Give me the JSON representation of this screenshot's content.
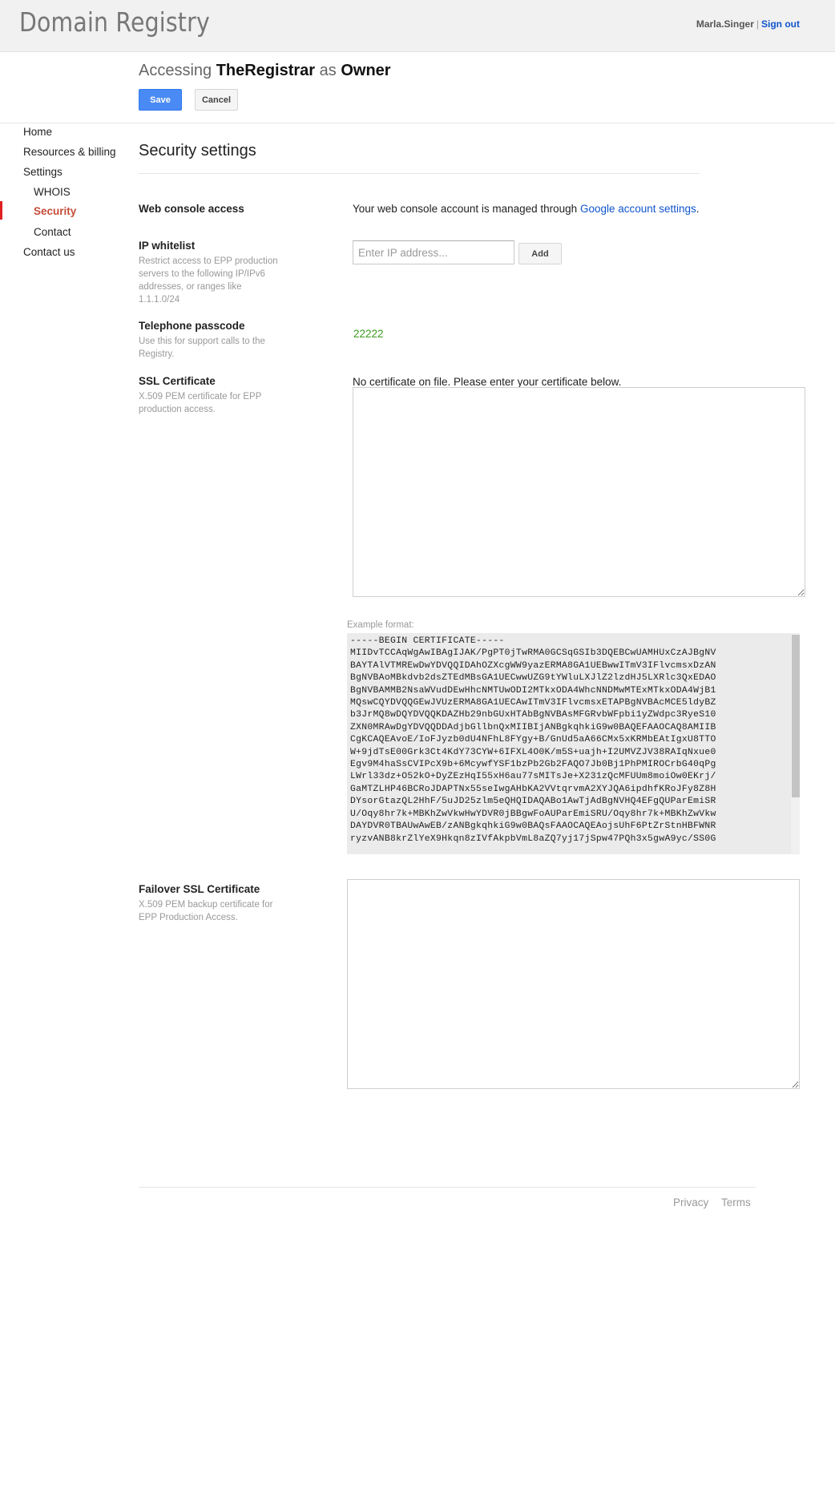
{
  "header": {
    "app_title": "Domain Registry",
    "username": "Marla.Singer",
    "separator": "|",
    "sign_out": "Sign out"
  },
  "access": {
    "prefix": "Accessing",
    "registrar": "TheRegistrar",
    "as": "as",
    "role": "Owner"
  },
  "toolbar": {
    "save_label": "Save",
    "cancel_label": "Cancel"
  },
  "sidebar": {
    "items": [
      {
        "label": "Home"
      },
      {
        "label": "Resources & billing"
      },
      {
        "label": "Settings"
      },
      {
        "label": "WHOIS"
      },
      {
        "label": "Security",
        "active": true
      },
      {
        "label": "Contact"
      },
      {
        "label": "Contact us"
      }
    ]
  },
  "main": {
    "title": "Security settings",
    "web_console": {
      "label": "Web console access",
      "text": "Your web console account is managed through ",
      "link": "Google account settings",
      "suffix": "."
    },
    "ip_whitelist": {
      "label": "IP whitelist",
      "description": "Restrict access to EPP production servers to the following IP/IPv6 addresses, or ranges like 1.1.1.0/24",
      "placeholder": "Enter IP address...",
      "add_label": "Add"
    },
    "passcode": {
      "label": "Telephone passcode",
      "description": "Use this for support calls to the Registry.",
      "value": "22222"
    },
    "ssl": {
      "label": "SSL Certificate",
      "description": "X.509 PEM certificate for EPP production access.",
      "status": "No certificate on file. Please enter your certificate below.",
      "value": ""
    },
    "example": {
      "label": "Example format:",
      "text": "-----BEGIN CERTIFICATE-----\nMIIDvTCCAqWgAwIBAgIJAK/PgPT0jTwRMA0GCSqGSIb3DQEBCwUAMHUxCzAJBgNV\nBAYTAlVTMREwDwYDVQQIDAhOZXcgWW9yazERMA8GA1UEBwwITmV3IFlvcmsxDzAN\nBgNVBAoMBkdvb2dsZTEdMBsGA1UECwwUZG9tYWluLXJlZ2lzdHJ5LXRlc3QxEDAO\nBgNVBAMMB2NsaWVudDEwHhcNMTUwODI2MTkxODA4WhcNNDMwMTExMTkxODA4WjB1\nMQswCQYDVQQGEwJVUzERMA8GA1UECAwITmV3IFlvcmsxETAPBgNVBAcMCE5ldyBZ\nb3JrMQ8wDQYDVQQKDAZHb29nbGUxHTAbBgNVBAsMFGRvbWFpbi1yZWdpc3RyeS10\nZXN0MRAwDgYDVQQDDAdjbGllbnQxMIIBIjANBgkqhkiG9w0BAQEFAAOCAQ8AMIIB\nCgKCAQEAvoE/IoFJyzb0dU4NFhL8FYgy+B/GnUd5aA66CMx5xKRMbEAtIgxU8TTO\nW+9jdTsE00Grk3Ct4KdY73CYW+6IFXL4O0K/m5S+uajh+I2UMVZJV38RAIqNxue0\nEgv9M4haSsCVIPcX9b+6McywfYSF1bzPb2Gb2FAQO7Jb0Bj1PhPMIROCrbG40qPg\nLWrl33dz+O52kO+DyZEzHqI55xH6au77sMITsJe+X231zQcMFUUm8moiOw0EKrj/\nGaMTZLHP46BCRoJDAPTNx55seIwgAHbKA2VVtqrvmA2XYJQA6ipdhfKRoJFy8Z8H\nDYsorGtazQL2HhF/5uJD25zlm5eQHQIDAQABo1AwTjAdBgNVHQ4EFgQUParEmiSR\nU/Oqy8hr7k+MBKhZwVkwHwYDVR0jBBgwFoAUParEmiSRU/Oqy8hr7k+MBKhZwVkw\nDAYDVR0TBAUwAwEB/zANBgkqhkiG9w0BAQsFAAOCAQEAojsUhF6PtZrStnHBFWNR\nryzvANB8krZlYeX9Hkqn8zIVfAkpbVmL8aZQ7yj17jSpw47PQh3x5gwA9yc/SS0G"
    },
    "failover": {
      "label": "Failover SSL Certificate",
      "description": "X.509 PEM backup certificate for EPP Production Access.",
      "value": ""
    }
  },
  "footer": {
    "privacy": "Privacy",
    "terms": "Terms"
  },
  "colors": {
    "accent_blue": "#4a8af4",
    "link": "#1155cc",
    "active_nav": "#c44d3a",
    "active_marker": "#e02020",
    "passcode_green": "#3d9a1f"
  }
}
